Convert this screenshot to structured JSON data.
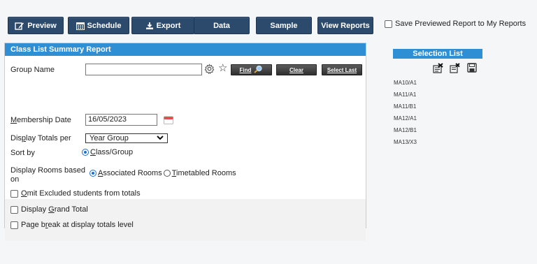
{
  "toolbar": {
    "preview": "Preview",
    "schedule": "Schedule",
    "export": "Export",
    "data": "Data",
    "sample": "Sample",
    "view_reports": "View Reports"
  },
  "save_previewed_label": "Save Previewed Report to My Reports",
  "panel_title": "Class List Summary Report",
  "group_name_label": "Group Name",
  "group_name_value": "",
  "buttons": {
    "find": "Find",
    "clear": "Clear",
    "select_last": "Select Last"
  },
  "membership_date": {
    "label_first": "M",
    "label_rest": "embership Date",
    "value": "16/05/2023"
  },
  "display_totals": {
    "label_a": "Dis",
    "label_u": "p",
    "label_b": "lay Totals per",
    "selected": "Year Group"
  },
  "sort_by": {
    "label": "Sort by",
    "option_u": "C",
    "option_rest": "lass/Group"
  },
  "display_rooms": {
    "label_line1": "Display Rooms based",
    "label_line2": "on",
    "opt1_u": "A",
    "opt1_rest": "ssociated Rooms",
    "opt2_u": "T",
    "opt2_rest": "imetabled Rooms"
  },
  "omit_excluded": {
    "u": "O",
    "rest": "mit Excluded students from totals"
  },
  "grand_total": {
    "a": "Display ",
    "u": "G",
    "b": "rand Total"
  },
  "page_break": {
    "a": "Page b",
    "u": "r",
    "b": "eak at display totals level"
  },
  "selection_list": {
    "title": "Selection List",
    "items": [
      "MA10/A1",
      "MA11/A1",
      "MA11/B1",
      "MA12/A1",
      "MA12/B1",
      "MA13/X3"
    ]
  },
  "colors": {
    "toolbar_button": "#2c4a6b",
    "panel_header": "#2f8fd5",
    "calendar": "#d9534f"
  }
}
